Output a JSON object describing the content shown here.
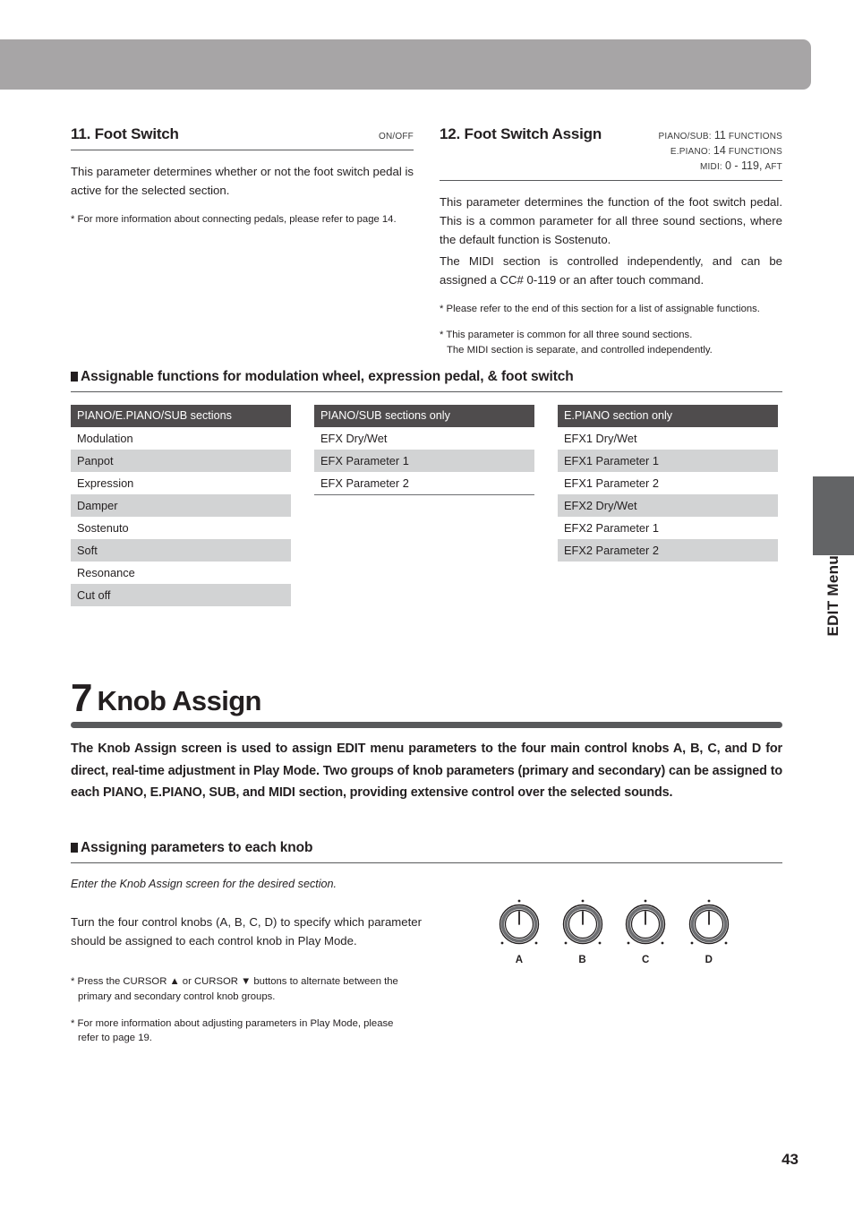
{
  "page": {
    "number": "43",
    "side_tab": "EDIT Menu"
  },
  "sections": {
    "foot_switch": {
      "title": "11. Foot Switch",
      "range": "ON/OFF",
      "paragraph1": "This parameter determines whether or not the foot switch pedal is active for the selected section.",
      "note1": "* For more information about connecting pedals, please refer to page 14."
    },
    "foot_switch_assign": {
      "title": "12. Foot Switch Assign",
      "range_lines": [
        {
          "label": "PIANO/SUB:",
          "value": "11",
          "unit": "FUNCTIONS"
        },
        {
          "label": "E.PIANO:",
          "value": "14",
          "unit": "FUNCTIONS"
        },
        {
          "label": "MIDI:",
          "value": "0 - 119,",
          "unit": "AFT"
        }
      ],
      "paragraph1": "This parameter determines the function of the foot switch pedal.  This is a common parameter for all three sound sections, where the default function is Sostenuto.",
      "paragraph2": "The MIDI section is controlled independently, and can be assigned a CC# 0-119 or an after touch command.",
      "note1": "* Please refer to the end of this section for a list of assignable functions.",
      "note2_line1": "* This parameter is common for all three sound sections.",
      "note2_line2": "The MIDI section is separate, and controlled independently."
    }
  },
  "assignable": {
    "heading": "Assignable functions for modulation wheel, expression pedal, & foot switch",
    "tables": [
      {
        "header": "PIANO/E.PIANO/SUB sections",
        "rows": [
          "Modulation",
          "Panpot",
          "Expression",
          "Damper",
          "Sostenuto",
          "Soft",
          "Resonance",
          "Cut off"
        ],
        "has_bottom_rule": false
      },
      {
        "header": "PIANO/SUB sections only",
        "rows": [
          "EFX Dry/Wet",
          "EFX Parameter 1",
          "EFX Parameter 2"
        ],
        "has_bottom_rule": true
      },
      {
        "header": "E.PIANO section only",
        "rows": [
          "EFX1 Dry/Wet",
          "EFX1 Parameter 1",
          "EFX1 Parameter 2",
          "EFX2 Dry/Wet",
          "EFX2 Parameter 1",
          "EFX2 Parameter 2"
        ],
        "has_bottom_rule": false
      }
    ]
  },
  "chapter": {
    "number": "7",
    "name": "Knob Assign",
    "intro": "The Knob Assign screen is used to assign EDIT menu parameters to the four main control knobs A, B, C, and D for direct, real-time adjustment in Play Mode.  Two groups of knob parameters (primary and secondary) can be assigned to each PIANO, E.PIANO, SUB, and MIDI section, providing extensive control over the selected sounds."
  },
  "assigning": {
    "heading": "Assigning parameters to each knob",
    "italic_line": "Enter the Knob Assign screen for the desired section.",
    "paragraph": "Turn the four control knobs (A, B, C, D) to specify which parameter should be assigned to each control knob in Play Mode.",
    "note1_line1": "* Press the CURSOR ▲ or CURSOR ▼ buttons to alternate between the",
    "note1_line2": "primary and secondary control knob groups.",
    "note2_line1": "* For more information about adjusting parameters in Play Mode, please",
    "note2_line2": "refer to page 19."
  },
  "knob_figure": {
    "knobs": [
      {
        "label": "A"
      },
      {
        "label": "B"
      },
      {
        "label": "C"
      },
      {
        "label": "D"
      }
    ]
  },
  "colors": {
    "banner": "#a7a5a6",
    "table_header": "#4f4c4d",
    "table_alt_row": "#d2d3d4",
    "chapter_bar": "#58595b",
    "side_tab": "#636466",
    "text": "#231f20"
  }
}
